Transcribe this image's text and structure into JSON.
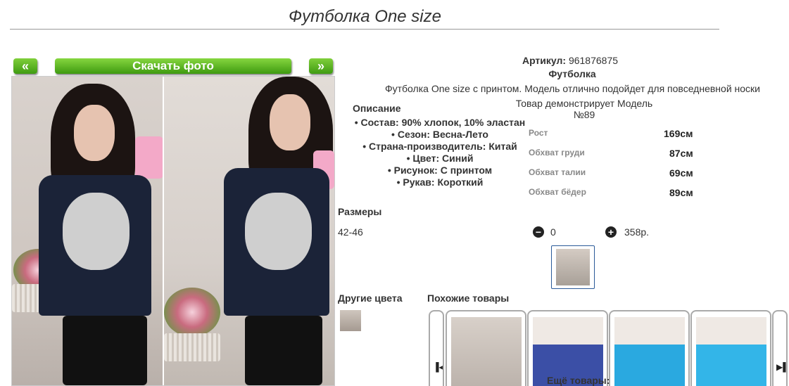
{
  "product": {
    "title": "Футболка One size",
    "article_label": "Артикул:",
    "article_value": "961876875",
    "category": "Футболка",
    "summary": "Футболка One size с принтом. Модель отлично подойдет для повседневной носки",
    "model_note": "Товар демонстрирует Модель №89"
  },
  "gallery": {
    "prev_label": "«",
    "next_label": "»",
    "download_label": "Скачать фото"
  },
  "description": {
    "title": "Описание",
    "items": [
      "Состав: 90% хлопок, 10% эластан",
      "Сезон: Весна-Лето",
      "Страна-производитель: Китай",
      "Цвет: Синий",
      "Рисунок: С принтом",
      "Рукав: Короткий"
    ]
  },
  "measurements": [
    {
      "label": "Рост",
      "value": "169см"
    },
    {
      "label": "Обхват груди",
      "value": "87см"
    },
    {
      "label": "Обхват талии",
      "value": "69см"
    },
    {
      "label": "Обхват бёдер",
      "value": "89см"
    }
  ],
  "sizes": {
    "title": "Размеры",
    "value": "42-46",
    "quantity": "0",
    "price": "358р.",
    "minus_icon": "minus-circle-icon",
    "plus_icon": "plus-circle-icon"
  },
  "other_colors": {
    "title": "Другие цвета"
  },
  "similar": {
    "title": "Похожие товары",
    "prev_icon": "carousel-prev-icon",
    "next_icon": "carousel-next-icon"
  },
  "more_label": "Ещё товары:"
}
